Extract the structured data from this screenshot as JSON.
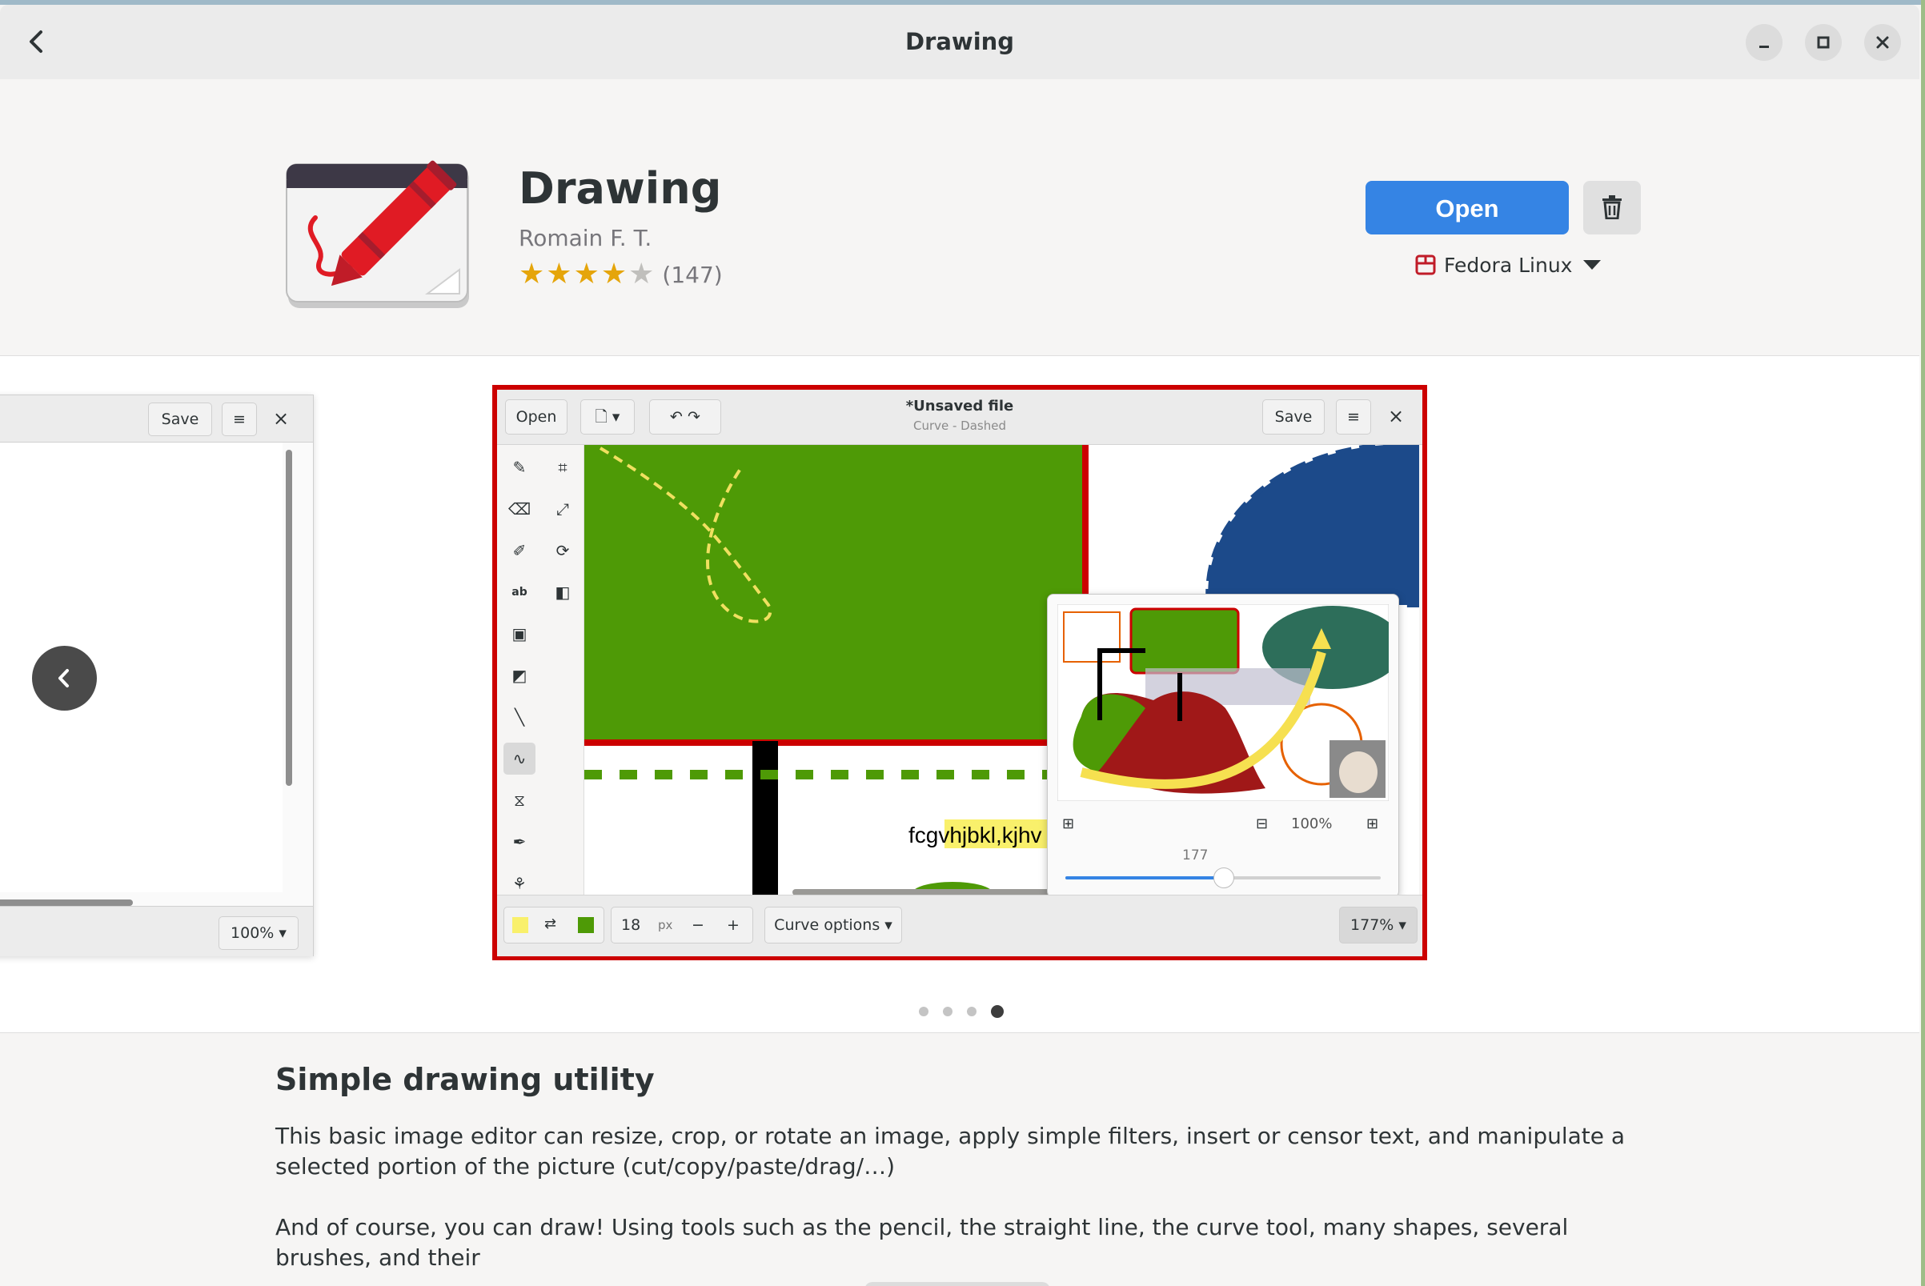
{
  "window": {
    "title": "Drawing"
  },
  "app": {
    "name": "Drawing",
    "developer": "Romain F. T.",
    "rating": {
      "stars_filled": 4,
      "stars_total": 5,
      "count": "(147)"
    },
    "open_label": "Open",
    "source": "Fedora Linux"
  },
  "screenshots": {
    "left": {
      "save_label": "Save",
      "menu_icon": "≡",
      "close_icon": "×",
      "zoom": "100%"
    },
    "main": {
      "open_label": "Open",
      "title": "*Unsaved file",
      "subtitle": "Curve - Dashed",
      "save_label": "Save",
      "menu_icon": "≡",
      "close_icon": "×",
      "canvas_text": "fcgvhjbkl,kjhv",
      "zoom_popover": {
        "percent": "100%",
        "slider_value": "177",
        "slider_fraction": 0.5
      },
      "footer": {
        "size_value": "18",
        "size_unit": "px",
        "minus": "−",
        "plus": "+",
        "options_label": "Curve options",
        "zoom": "177%"
      }
    },
    "pager": {
      "count": 4,
      "active_index": 3
    }
  },
  "description": {
    "heading": "Simple drawing utility",
    "paragraphs": [
      "This basic image editor can resize, crop, or rotate an image, apply simple filters, insert or censor text, and manipulate a selected portion of the picture (cut/copy/paste/drag/…)",
      "And of course, you can draw! Using tools such as the pencil, the straight line, the curve tool, many shapes, several brushes, and their"
    ]
  },
  "colors": {
    "accent": "#3584e4",
    "highlight_border": "#cc0000",
    "star": "#e5a50a"
  }
}
